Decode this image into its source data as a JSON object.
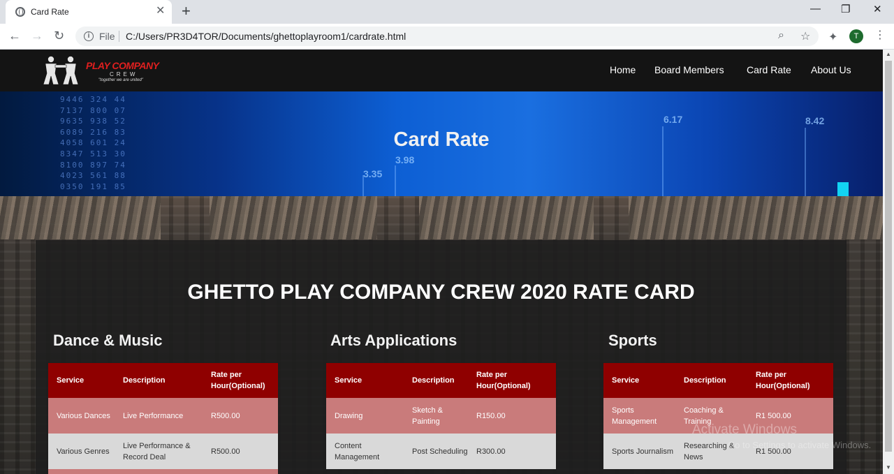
{
  "browser": {
    "tab_title": "Card Rate",
    "tab_close": "✕",
    "new_tab": "+",
    "file_label": "File",
    "url": "C:/Users/PR3D4TOR/Documents/ghettoplayroom1/cardrate.html",
    "profile_initial": "T",
    "window_controls": [
      "—",
      "❐",
      "✕"
    ]
  },
  "site": {
    "logo": {
      "main": "PLAY COMPANY",
      "sub": "CREW",
      "tagline": "\"together we are united\""
    },
    "nav": [
      "Home",
      "Board Members",
      "Card Rate",
      "About Us"
    ]
  },
  "hero": {
    "title": "Card Rate",
    "numbers": [
      "3.35",
      "3.98",
      "6.17",
      "8.42"
    ]
  },
  "rate_card": {
    "title": "GHETTO PLAY COMPANY CREW 2020 RATE CARD",
    "headers": [
      "Service",
      "Description",
      "Rate per Hour(Optional)"
    ],
    "categories": [
      {
        "name": "Dance & Music",
        "rows": [
          {
            "service": "Various Dances",
            "description": "Live Performance",
            "rate": "R500.00"
          },
          {
            "service": "Various Genres",
            "description": "Live Performance & Record Deal",
            "rate": "R500.00"
          }
        ]
      },
      {
        "name": "Arts Applications",
        "rows": [
          {
            "service": "Drawing",
            "description": "Sketch & Painting",
            "rate": "R150.00"
          },
          {
            "service": "Content Management",
            "description": "Post Scheduling",
            "rate": "R300.00"
          }
        ]
      },
      {
        "name": "Sports",
        "rows": [
          {
            "service": "Sports Management",
            "description": "Coaching & Training",
            "rate": "R1 500.00"
          },
          {
            "service": "Sports Journalism",
            "description": "Researching & News",
            "rate": "R1 500.00"
          }
        ]
      }
    ]
  },
  "os_watermark": {
    "line1": "Activate Windows",
    "line2": "Go to Settings to activate Windows."
  },
  "colors": {
    "nav_bg": "#141414",
    "table_header": "#8f0000",
    "row_highlight": "#c97b7b",
    "row_alt": "#d9d9d9",
    "logo_red": "#e01f1f",
    "hero_accent": "#12d3f3"
  }
}
